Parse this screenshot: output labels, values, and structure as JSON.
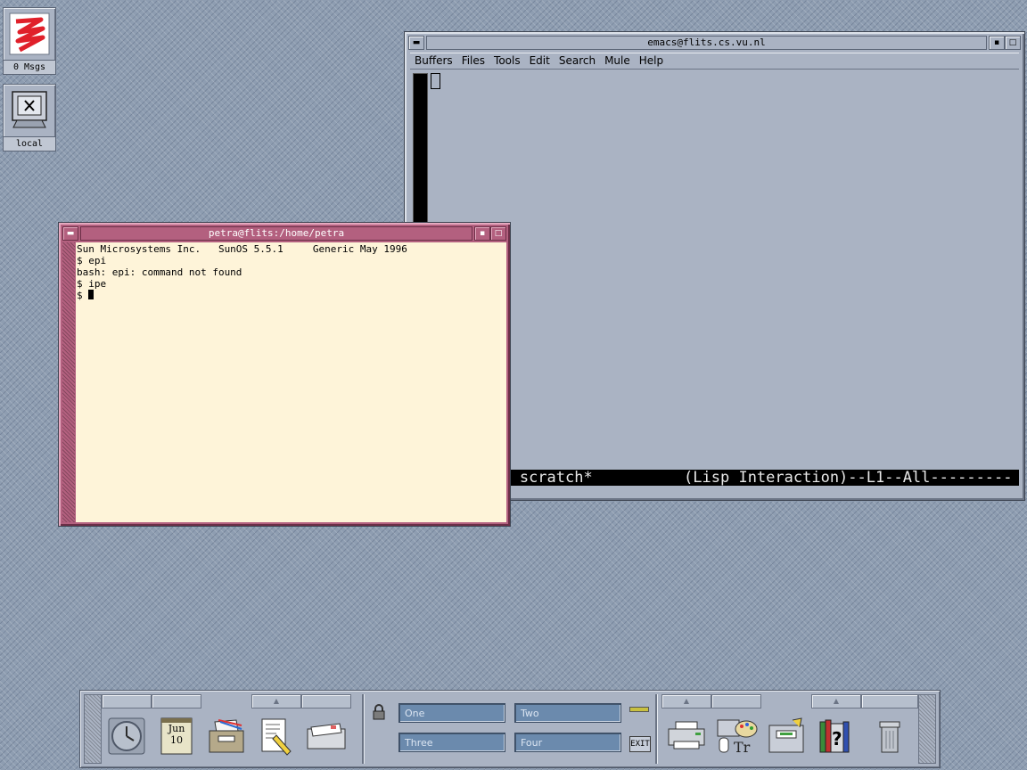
{
  "desktop": {
    "mail_icon_label": "0 Msgs",
    "local_icon_label": "local"
  },
  "emacs": {
    "title": "emacs@flits.cs.vu.nl",
    "menu": [
      "Buffers",
      "Files",
      "Tools",
      "Edit",
      "Search",
      "Mule",
      "Help"
    ],
    "modeline": "scratch*          (Lisp Interaction)--L1--All---------"
  },
  "terminal": {
    "title": "petra@flits:/home/petra",
    "lines": [
      "Sun Microsystems Inc.   SunOS 5.5.1     Generic May 1996",
      "$ epi",
      "bash: epi: command not found",
      "$ ipe",
      "$ "
    ]
  },
  "front_panel": {
    "calendar_month": "Jun",
    "calendar_day": "10",
    "workspaces": [
      "One",
      "Two",
      "Three",
      "Four"
    ],
    "exit_label": "EXIT"
  },
  "colors": {
    "desktop": "#8e9db1",
    "emacs_frame": "#aab3c3",
    "terminal_frame": "#b3607f",
    "terminal_bg": "#fef4d9",
    "workspace_button": "#6b8aad"
  },
  "icons": [
    "mail-icon",
    "monitor-icon",
    "clock-icon",
    "calendar-icon",
    "file-manager-icon",
    "text-editor-icon",
    "mail-tray-icon",
    "lock-icon",
    "printer-icon",
    "style-manager-icon",
    "app-manager-icon",
    "help-icon",
    "trash-icon"
  ]
}
